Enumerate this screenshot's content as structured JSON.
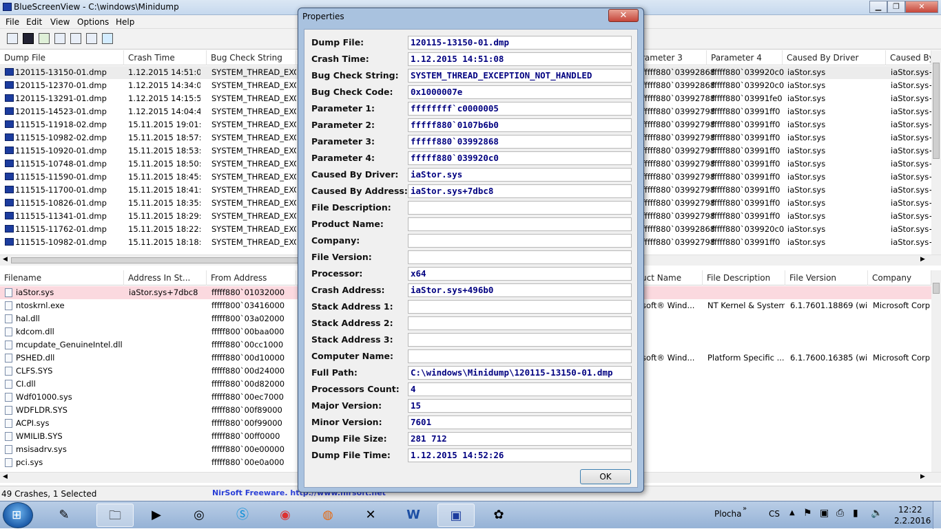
{
  "window": {
    "title": "BlueScreenView  -  C:\\windows\\Minidump"
  },
  "menu": [
    "File",
    "Edit",
    "View",
    "Options",
    "Help"
  ],
  "top_list": {
    "headers": [
      "Dump File",
      "Crash Time",
      "Bug Check String",
      "rameter 3",
      "Parameter 4",
      "Caused By Driver",
      "Caused By"
    ],
    "rows": [
      {
        "file": "120115-13150-01.dmp",
        "time": "1.12.2015 14:51:08",
        "bug": "SYSTEM_THREAD_EXCE",
        "p3": "fffff880`03992868",
        "p4": "fffff880`039920c0",
        "drv": "iaStor.sys",
        "addr": "iaStor.sys+"
      },
      {
        "file": "120115-12370-01.dmp",
        "time": "1.12.2015 14:34:02",
        "bug": "SYSTEM_THREAD_EXCE",
        "p3": "fffff880`03992868",
        "p4": "fffff880`039920c0",
        "drv": "iaStor.sys",
        "addr": "iaStor.sys+"
      },
      {
        "file": "120115-13291-01.dmp",
        "time": "1.12.2015 14:15:53",
        "bug": "SYSTEM_THREAD_EXCE",
        "p3": "fffff880`03992788",
        "p4": "fffff880`03991fe0",
        "drv": "iaStor.sys",
        "addr": "iaStor.sys+"
      },
      {
        "file": "120115-14523-01.dmp",
        "time": "1.12.2015 14:04:45",
        "bug": "SYSTEM_THREAD_EXCE",
        "p3": "fffff880`03992798",
        "p4": "fffff880`03991ff0",
        "drv": "iaStor.sys",
        "addr": "iaStor.sys+"
      },
      {
        "file": "111515-11918-02.dmp",
        "time": "15.11.2015 19:01:58",
        "bug": "SYSTEM_THREAD_EXCE",
        "p3": "fffff880`03992798",
        "p4": "fffff880`03991ff0",
        "drv": "iaStor.sys",
        "addr": "iaStor.sys+"
      },
      {
        "file": "111515-10982-02.dmp",
        "time": "15.11.2015 18:57:54",
        "bug": "SYSTEM_THREAD_EXCE",
        "p3": "fffff880`03992798",
        "p4": "fffff880`03991ff0",
        "drv": "iaStor.sys",
        "addr": "iaStor.sys+"
      },
      {
        "file": "111515-10920-01.dmp",
        "time": "15.11.2015 18:53:14",
        "bug": "SYSTEM_THREAD_EXCE",
        "p3": "fffff880`03992798",
        "p4": "fffff880`03991ff0",
        "drv": "iaStor.sys",
        "addr": "iaStor.sys+"
      },
      {
        "file": "111515-10748-01.dmp",
        "time": "15.11.2015 18:50:09",
        "bug": "SYSTEM_THREAD_EXCE",
        "p3": "fffff880`03992798",
        "p4": "fffff880`03991ff0",
        "drv": "iaStor.sys",
        "addr": "iaStor.sys+"
      },
      {
        "file": "111515-11590-01.dmp",
        "time": "15.11.2015 18:45:44",
        "bug": "SYSTEM_THREAD_EXCE",
        "p3": "fffff880`03992798",
        "p4": "fffff880`03991ff0",
        "drv": "iaStor.sys",
        "addr": "iaStor.sys+"
      },
      {
        "file": "111515-11700-01.dmp",
        "time": "15.11.2015 18:41:16",
        "bug": "SYSTEM_THREAD_EXCE",
        "p3": "fffff880`03992798",
        "p4": "fffff880`03991ff0",
        "drv": "iaStor.sys",
        "addr": "iaStor.sys+"
      },
      {
        "file": "111515-10826-01.dmp",
        "time": "15.11.2015 18:35:02",
        "bug": "SYSTEM_THREAD_EXCE",
        "p3": "fffff880`03992798",
        "p4": "fffff880`03991ff0",
        "drv": "iaStor.sys",
        "addr": "iaStor.sys+"
      },
      {
        "file": "111515-11341-01.dmp",
        "time": "15.11.2015 18:29:12",
        "bug": "SYSTEM_THREAD_EXCE",
        "p3": "fffff880`03992798",
        "p4": "fffff880`03991ff0",
        "drv": "iaStor.sys",
        "addr": "iaStor.sys+"
      },
      {
        "file": "111515-11762-01.dmp",
        "time": "15.11.2015 18:22:34",
        "bug": "SYSTEM_THREAD_EXCE",
        "p3": "fffff880`03992868",
        "p4": "fffff880`039920c0",
        "drv": "iaStor.sys",
        "addr": "iaStor.sys+"
      },
      {
        "file": "111515-10982-01.dmp",
        "time": "15.11.2015 18:18:03",
        "bug": "SYSTEM_THREAD_EXCE",
        "p3": "fffff880`03992798",
        "p4": "fffff880`03991ff0",
        "drv": "iaStor.sys",
        "addr": "iaStor.sys+"
      }
    ]
  },
  "bottom_list": {
    "headers": [
      "Filename",
      "Address In St...",
      "From Address",
      "uct Name",
      "File Description",
      "File Version",
      "Company"
    ],
    "rows": [
      {
        "name": "iaStor.sys",
        "stack": "iaStor.sys+7dbc8",
        "from": "fffff880`01032000",
        "prod": "",
        "desc": "",
        "ver": "",
        "comp": ""
      },
      {
        "name": "ntoskrnl.exe",
        "stack": "",
        "from": "fffff800`03416000",
        "prod": "osoft® Wind...",
        "desc": "NT Kernel & System",
        "ver": "6.1.7601.18869 (wi...",
        "comp": "Microsoft Corp"
      },
      {
        "name": "hal.dll",
        "stack": "",
        "from": "fffff800`03a02000",
        "prod": "",
        "desc": "",
        "ver": "",
        "comp": ""
      },
      {
        "name": "kdcom.dll",
        "stack": "",
        "from": "fffff800`00baa000",
        "prod": "",
        "desc": "",
        "ver": "",
        "comp": ""
      },
      {
        "name": "mcupdate_GenuineIntel.dll",
        "stack": "",
        "from": "fffff880`00cc1000",
        "prod": "",
        "desc": "",
        "ver": "",
        "comp": ""
      },
      {
        "name": "PSHED.dll",
        "stack": "",
        "from": "fffff880`00d10000",
        "prod": "osoft® Wind...",
        "desc": "Platform Specific ...",
        "ver": "6.1.7600.16385 (wi...",
        "comp": "Microsoft Corp"
      },
      {
        "name": "CLFS.SYS",
        "stack": "",
        "from": "fffff880`00d24000",
        "prod": "",
        "desc": "",
        "ver": "",
        "comp": ""
      },
      {
        "name": "CI.dll",
        "stack": "",
        "from": "fffff880`00d82000",
        "prod": "",
        "desc": "",
        "ver": "",
        "comp": ""
      },
      {
        "name": "Wdf01000.sys",
        "stack": "",
        "from": "fffff880`00ec7000",
        "prod": "",
        "desc": "",
        "ver": "",
        "comp": ""
      },
      {
        "name": "WDFLDR.SYS",
        "stack": "",
        "from": "fffff880`00f89000",
        "prod": "",
        "desc": "",
        "ver": "",
        "comp": ""
      },
      {
        "name": "ACPI.sys",
        "stack": "",
        "from": "fffff880`00f99000",
        "prod": "",
        "desc": "",
        "ver": "",
        "comp": ""
      },
      {
        "name": "WMILIB.SYS",
        "stack": "",
        "from": "fffff880`00ff0000",
        "prod": "",
        "desc": "",
        "ver": "",
        "comp": ""
      },
      {
        "name": "msisadrv.sys",
        "stack": "",
        "from": "fffff880`00e00000",
        "prod": "",
        "desc": "",
        "ver": "",
        "comp": ""
      },
      {
        "name": "pci.sys",
        "stack": "",
        "from": "fffff880`00e0a000",
        "prod": "",
        "desc": "",
        "ver": "",
        "comp": ""
      }
    ]
  },
  "status": {
    "count": "49 Crashes, 1 Selected",
    "link": "NirSoft Freeware.  http://www.nirsoft.net"
  },
  "dialog": {
    "title": "Properties",
    "ok": "OK",
    "fields": [
      {
        "label": "Dump File:",
        "value": "120115-13150-01.dmp"
      },
      {
        "label": "Crash Time:",
        "value": "1.12.2015 14:51:08"
      },
      {
        "label": "Bug Check String:",
        "value": "SYSTEM_THREAD_EXCEPTION_NOT_HANDLED"
      },
      {
        "label": "Bug Check Code:",
        "value": "0x1000007e"
      },
      {
        "label": "Parameter 1:",
        "value": "ffffffff`c0000005"
      },
      {
        "label": "Parameter 2:",
        "value": "fffff880`0107b6b0"
      },
      {
        "label": "Parameter 3:",
        "value": "fffff880`03992868"
      },
      {
        "label": "Parameter 4:",
        "value": "fffff880`039920c0"
      },
      {
        "label": "Caused By Driver:",
        "value": "iaStor.sys"
      },
      {
        "label": "Caused By Address:",
        "value": "iaStor.sys+7dbc8"
      },
      {
        "label": "File Description:",
        "value": ""
      },
      {
        "label": "Product Name:",
        "value": ""
      },
      {
        "label": "Company:",
        "value": ""
      },
      {
        "label": "File Version:",
        "value": ""
      },
      {
        "label": "Processor:",
        "value": "x64"
      },
      {
        "label": "Crash Address:",
        "value": "iaStor.sys+496b0"
      },
      {
        "label": "Stack Address 1:",
        "value": ""
      },
      {
        "label": "Stack Address 2:",
        "value": ""
      },
      {
        "label": "Stack Address 3:",
        "value": ""
      },
      {
        "label": "Computer Name:",
        "value": ""
      },
      {
        "label": "Full Path:",
        "value": "C:\\windows\\Minidump\\120115-13150-01.dmp"
      },
      {
        "label": "Processors Count:",
        "value": "4"
      },
      {
        "label": "Major Version:",
        "value": "15"
      },
      {
        "label": "Minor Version:",
        "value": "7601"
      },
      {
        "label": "Dump File Size:",
        "value": "281 712"
      },
      {
        "label": "Dump File Time:",
        "value": "1.12.2015 14:52:26"
      }
    ]
  },
  "taskbar": {
    "toolbar_label": "Plocha",
    "lang": "CS",
    "time": "12:22",
    "date": "2.2.2016"
  },
  "colors": {
    "dialog_value": "#000080",
    "selected_row_top": "#ececec",
    "selected_row_bottom": "#fbd9df"
  }
}
